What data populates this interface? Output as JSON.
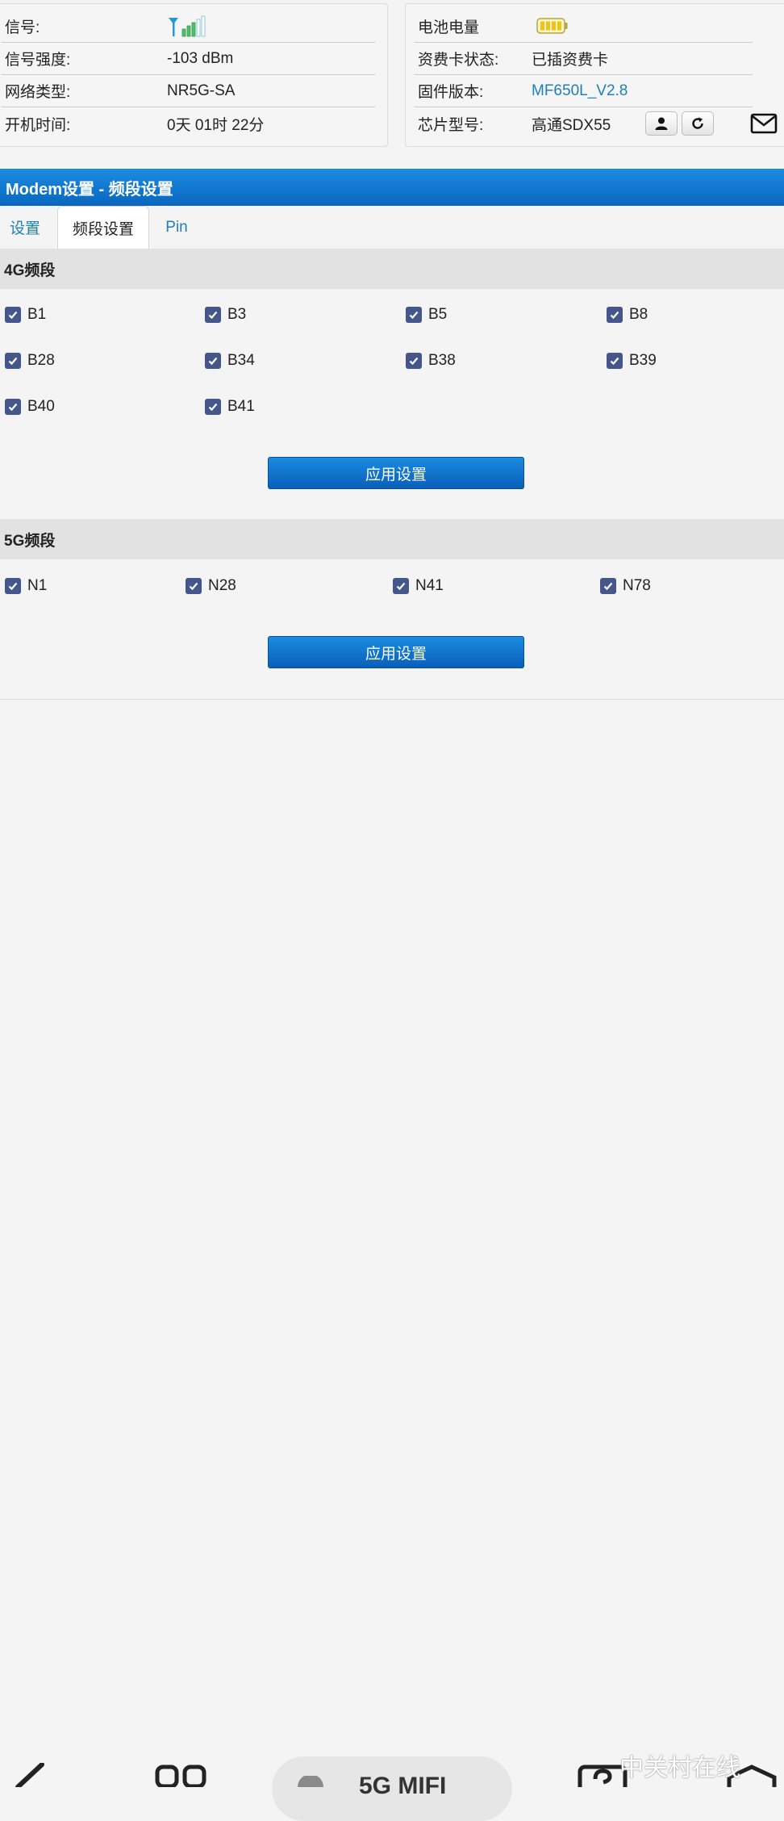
{
  "status_left": {
    "signal_label": "信号:",
    "strength_label": "信号强度:",
    "strength_value": "-103 dBm",
    "nettype_label": "网络类型:",
    "nettype_value": "NR5G-SA",
    "uptime_label": "开机时间:",
    "uptime_value": "0天 01时 22分"
  },
  "status_right": {
    "battery_label": "电池电量",
    "sim_label": "资费卡状态:",
    "sim_value": "已插资费卡",
    "firmware_label": "固件版本:",
    "firmware_value": "MF650L_V2.8",
    "chip_label": "芯片型号:",
    "chip_value": "高通SDX55"
  },
  "colors": {
    "accent": "#0a66bf",
    "link": "#1f7fb8",
    "checkbox": "#45578a"
  },
  "title": "Modem设置 - 频段设置",
  "tabs": [
    "设置",
    "频段设置",
    "Pin"
  ],
  "active_tab": "频段设置",
  "band4g": {
    "title": "4G频段",
    "items": [
      "B1",
      "B3",
      "B5",
      "B8",
      "B28",
      "B34",
      "B38",
      "B39",
      "B40",
      "B41"
    ],
    "apply_label": "应用设置"
  },
  "band5g": {
    "title": "5G频段",
    "items": [
      "N1",
      "N28",
      "N41",
      "N78"
    ],
    "apply_label": "应用设置"
  },
  "bottom": {
    "pill_label": "5G MIFI",
    "watermark": "中关村在线"
  },
  "icons": [
    "signal-icon",
    "battery-icon",
    "user-icon",
    "refresh-icon",
    "mail-icon",
    "checkbox-checked-icon"
  ]
}
